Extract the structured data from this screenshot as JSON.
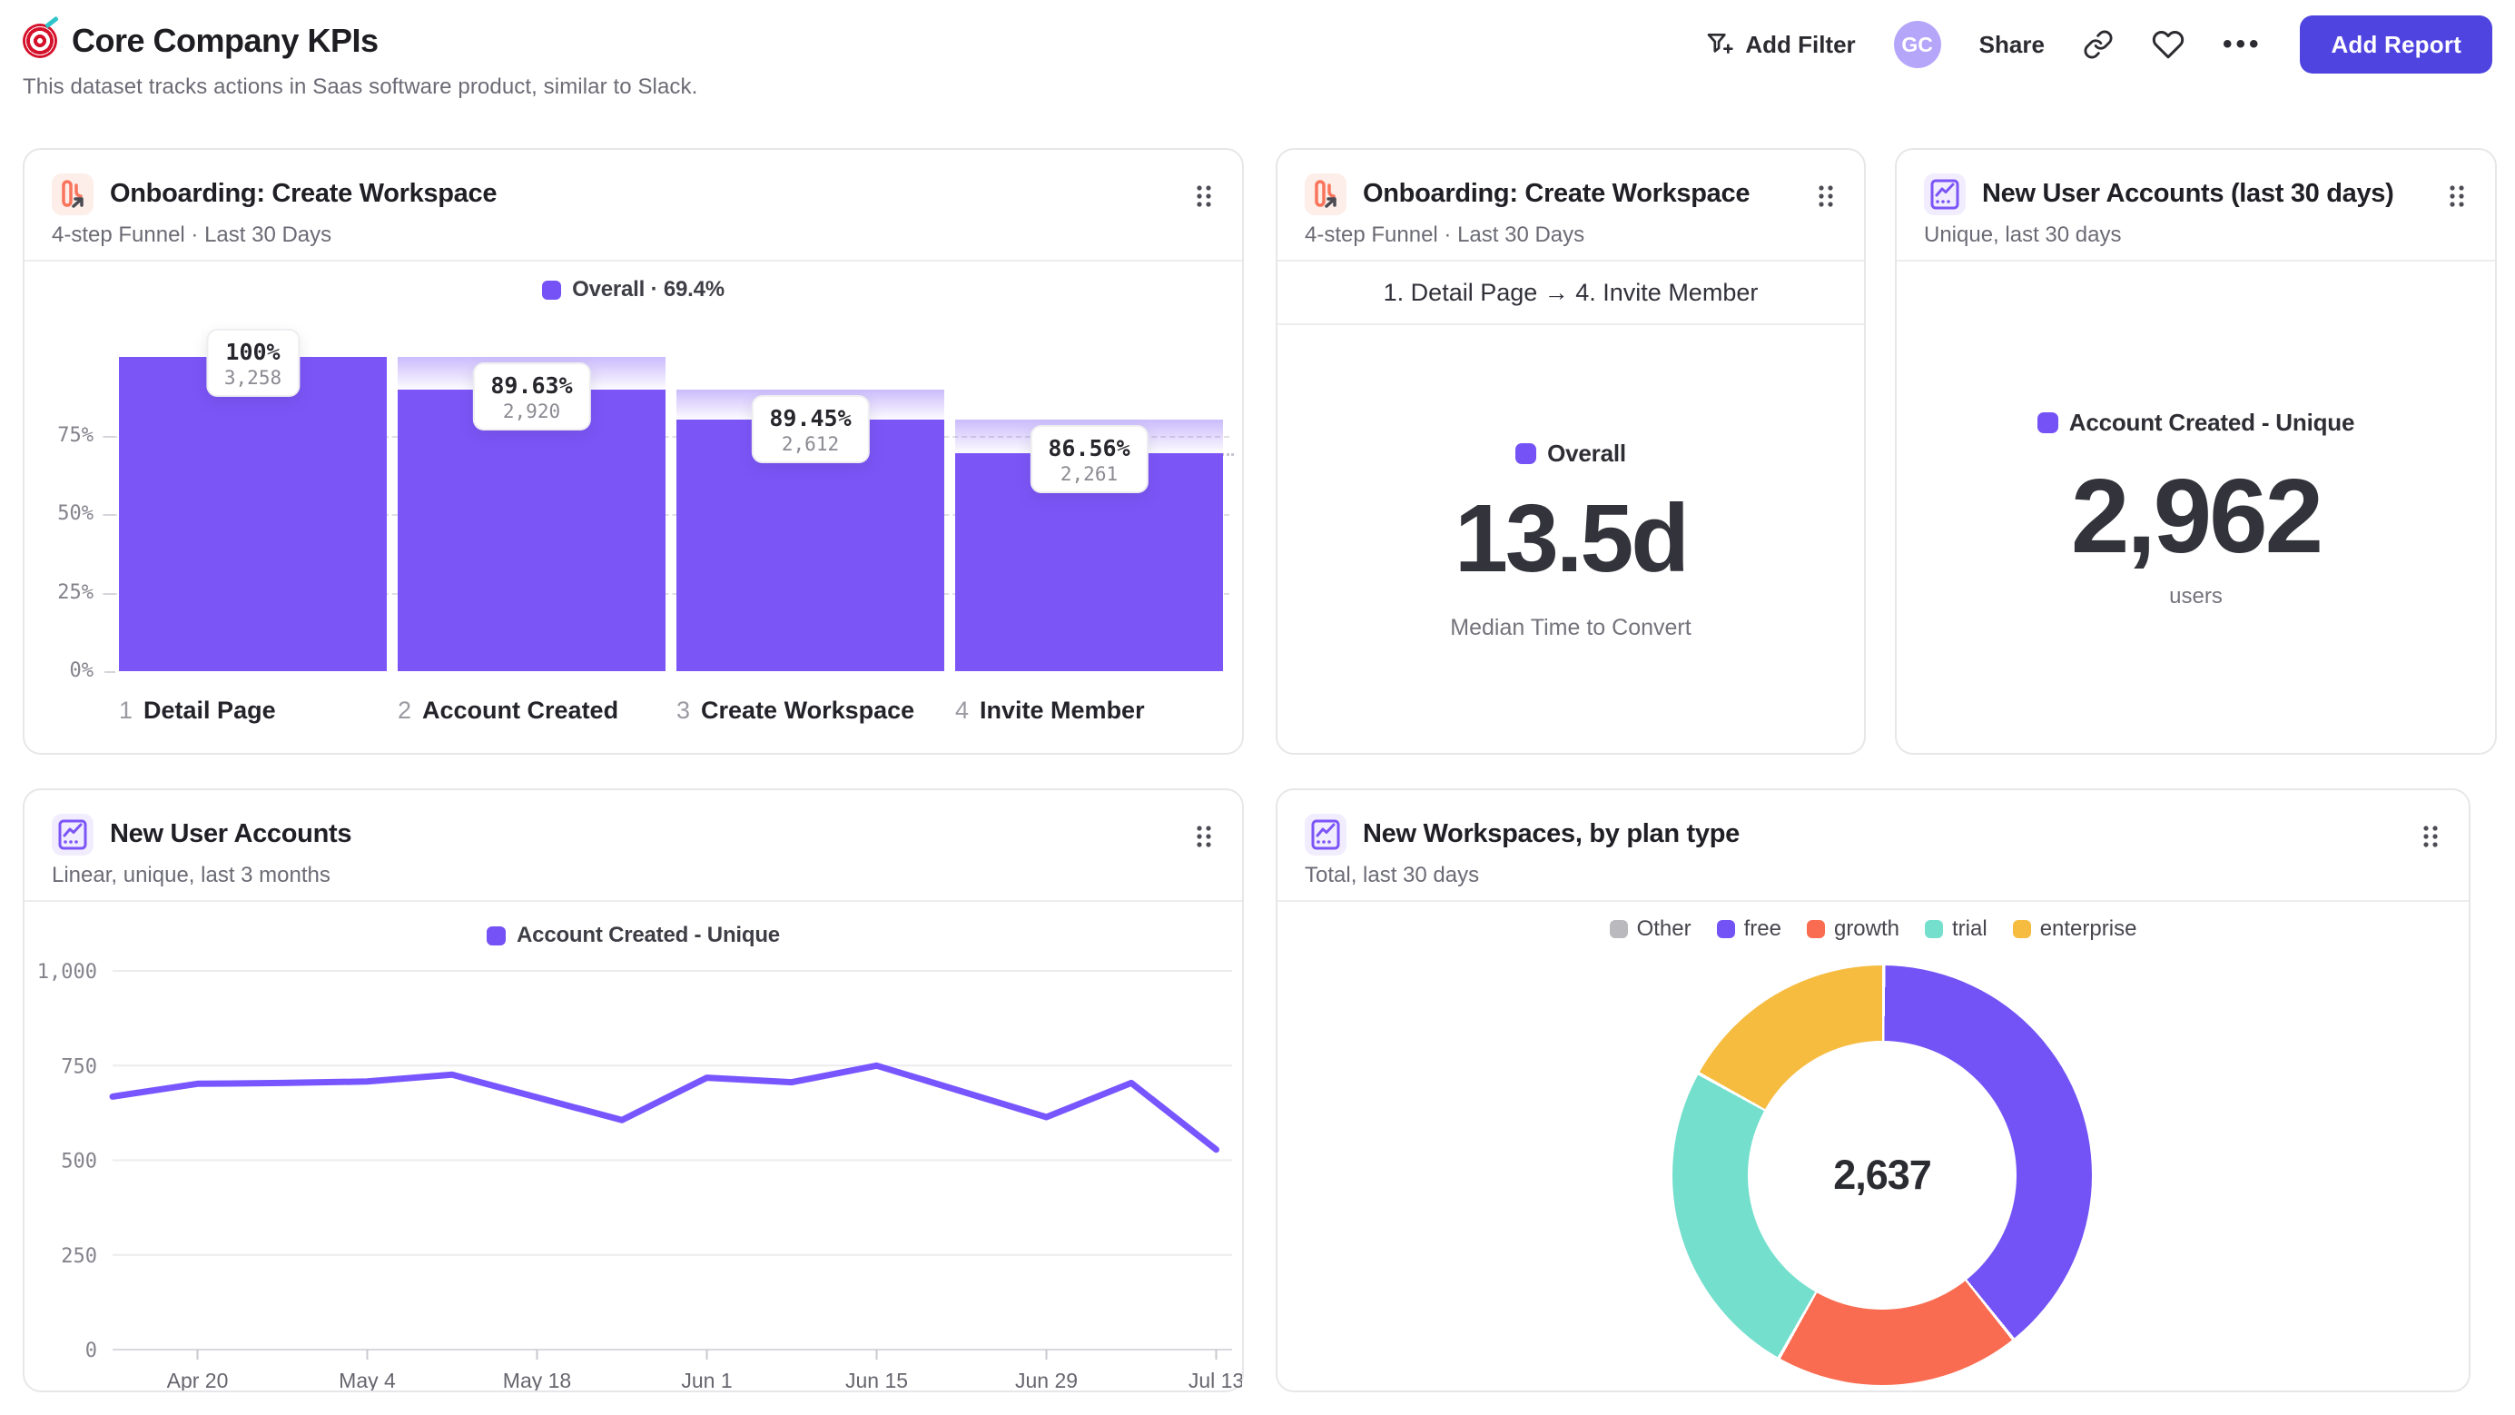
{
  "page": {
    "title": "Core Company KPIs",
    "subtitle": "This dataset tracks actions in Saas software product, similar to Slack."
  },
  "toolbar": {
    "add_filter": "Add Filter",
    "avatar_initials": "GC",
    "share": "Share",
    "more": "•••",
    "add_report": "Add Report"
  },
  "cards": {
    "funnel": {
      "title": "Onboarding: Create Workspace",
      "subtitle": "4-step Funnel · Last 30 Days",
      "legend": "Overall · 69.4%"
    },
    "ttc": {
      "title": "Onboarding: Create Workspace",
      "subtitle": "4-step Funnel · Last 30 Days",
      "range_row": "1. Detail Page → 4. Invite Member",
      "legend": "Overall",
      "value": "13.5d",
      "caption": "Median Time to Convert"
    },
    "metric": {
      "title": "New User Accounts (last 30 days)",
      "subtitle": "Unique, last 30 days",
      "legend": "Account Created - Unique",
      "value": "2,962",
      "caption": "users"
    },
    "line": {
      "title": "New User Accounts",
      "subtitle": "Linear, unique, last 3 months",
      "legend": "Account Created - Unique"
    },
    "donut": {
      "title": "New Workspaces, by plan type",
      "subtitle": "Total, last 30 days",
      "center_value": "2,637"
    }
  },
  "colors": {
    "accent_purple": "#7c55f7",
    "legend_purple": "#7452f5",
    "line_purple": "#7856ff",
    "button_indigo": "#4f44e0",
    "avatar_lilac": "#b5a6fa",
    "icon_coral": "#f8745c"
  },
  "chart_data": [
    {
      "id": "onboarding_funnel",
      "type": "bar",
      "title": "Onboarding: Create Workspace",
      "legend": "Overall · 69.4%",
      "step_numbers": [
        "1",
        "2",
        "3",
        "4"
      ],
      "categories": [
        "Detail Page",
        "Account Created",
        "Create Workspace",
        "Invite Member"
      ],
      "values": [
        3258,
        2920,
        2612,
        2261
      ],
      "value_labels": [
        "3,258",
        "2,920",
        "2,612",
        "2,261"
      ],
      "conversion_labels": [
        "100%",
        "89.63%",
        "89.45%",
        "86.56%"
      ],
      "overall_conversion": "69.4%",
      "ytick_pcts": [
        0,
        25,
        50,
        75
      ],
      "ytick_labels": [
        "0%",
        "25%",
        "50%",
        "75%"
      ],
      "bar_color": "#7c55f7"
    },
    {
      "id": "median_time_to_convert",
      "type": "metric",
      "series": "Overall",
      "value": "13.5d",
      "label": "Median Time to Convert",
      "range": "1. Detail Page → 4. Invite Member"
    },
    {
      "id": "new_user_accounts_30d",
      "type": "metric",
      "series": "Account Created - Unique",
      "value": "2,962",
      "label": "users"
    },
    {
      "id": "new_user_accounts_line",
      "type": "line",
      "series_name": "Account Created - Unique",
      "x": [
        "Apr 13",
        "Apr 20",
        "Apr 27",
        "May 4",
        "May 11",
        "May 18",
        "May 25",
        "Jun 1",
        "Jun 8",
        "Jun 15",
        "Jun 22",
        "Jun 29",
        "Jul 6",
        "Jul 13"
      ],
      "values": [
        668,
        702,
        704,
        708,
        726,
        666,
        606,
        718,
        706,
        750,
        682,
        614,
        704,
        528
      ],
      "xtick_labels": [
        "Apr 20",
        "May 4",
        "May 18",
        "Jun 1",
        "Jun 15",
        "Jun 29",
        "Jul 13"
      ],
      "xtick_indices": [
        1,
        3,
        5,
        7,
        9,
        11,
        13
      ],
      "yticks": [
        0,
        250,
        500,
        750,
        1000
      ],
      "ytick_labels": [
        "0",
        "250",
        "500",
        "750",
        "1,000"
      ],
      "ylim": [
        0,
        1000
      ],
      "line_color": "#7856ff",
      "grid": true,
      "legend_position": "top"
    },
    {
      "id": "new_workspaces_by_plan",
      "type": "pie",
      "total_label": "2,637",
      "total": 2637,
      "legend_position": "top",
      "segments": [
        {
          "name": "Other",
          "value": 0,
          "color": "#b9b9be"
        },
        {
          "name": "free",
          "value": 1032,
          "color": "#7453f6"
        },
        {
          "name": "growth",
          "value": 499,
          "color": "#f96c51"
        },
        {
          "name": "trial",
          "value": 656,
          "color": "#74dfcd"
        },
        {
          "name": "enterprise",
          "value": 450,
          "color": "#f6bc40"
        }
      ]
    }
  ]
}
